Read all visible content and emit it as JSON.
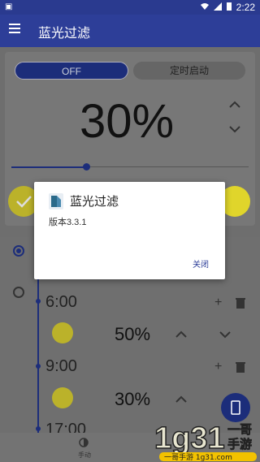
{
  "status_bar": {
    "time": "2:22"
  },
  "app_bar": {
    "title": "蓝光过滤"
  },
  "filter_card": {
    "off_label": "OFF",
    "timer_label": "定时启动",
    "intensity": "30%",
    "slider_level": 0.3,
    "swatch_colors": [
      "#bbb22a",
      "#e08a2a",
      "#3a3a3a",
      "#c0392b",
      "#c0392b",
      "#e0d52b"
    ]
  },
  "schedule": {
    "entries": [
      {
        "time": "6:00",
        "percent": "50%"
      },
      {
        "time": "9:00",
        "percent": "30%"
      },
      {
        "time": "17:00"
      }
    ]
  },
  "bottom_nav": {
    "label": "手动"
  },
  "watermark": {
    "text": "1g31 一哥手游 1g31.com"
  },
  "dialog": {
    "title": "蓝光过滤",
    "version": "版本3.3.1",
    "close_label": "关闭"
  },
  "colors": {
    "primary": "#2d3e98",
    "accent_yellow": "#bbb22a"
  }
}
